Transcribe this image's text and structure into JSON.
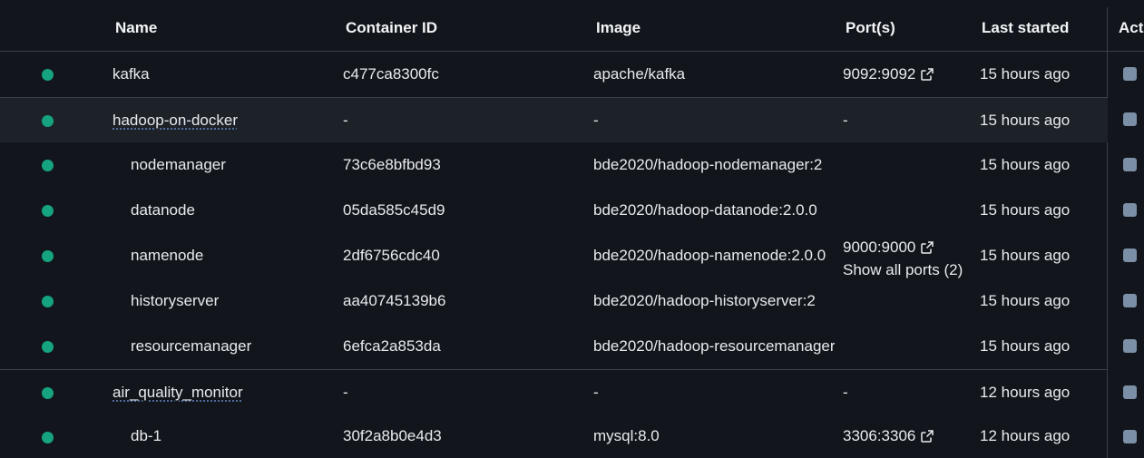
{
  "header": {
    "name": "Name",
    "container_id": "Container ID",
    "image": "Image",
    "ports": "Port(s)",
    "last_started": "Last started",
    "actions": "Act"
  },
  "rows": [
    {
      "name": "kafka",
      "container_id": "c477ca8300fc",
      "image": "apache/kafka",
      "ports": "9092:9092",
      "last_started": "15 hours ago",
      "status": "running",
      "is_group": false
    },
    {
      "name": "hadoop-on-docker",
      "container_id": "-",
      "image": "-",
      "ports": "-",
      "last_started": "15 hours ago",
      "status": "running",
      "is_group": true
    },
    {
      "name": "nodemanager",
      "container_id": "73c6e8bfbd93",
      "image": "bde2020/hadoop-nodemanager:2",
      "ports": "",
      "last_started": "15 hours ago",
      "status": "running",
      "is_group": false
    },
    {
      "name": "datanode",
      "container_id": "05da585c45d9",
      "image": "bde2020/hadoop-datanode:2.0.0",
      "ports": "",
      "last_started": "15 hours ago",
      "status": "running",
      "is_group": false
    },
    {
      "name": "namenode",
      "container_id": "2df6756cdc40",
      "image": "bde2020/hadoop-namenode:2.0.0",
      "ports": "9000:9000",
      "ports_more": "Show all ports (2)",
      "last_started": "15 hours ago",
      "status": "running",
      "is_group": false
    },
    {
      "name": "historyserver",
      "container_id": "aa40745139b6",
      "image": "bde2020/hadoop-historyserver:2",
      "ports": "",
      "last_started": "15 hours ago",
      "status": "running",
      "is_group": false
    },
    {
      "name": "resourcemanager",
      "container_id": "6efca2a853da",
      "image": "bde2020/hadoop-resourcemanager",
      "ports": "",
      "last_started": "15 hours ago",
      "status": "running",
      "is_group": false
    },
    {
      "name": "air_quality_monitor",
      "container_id": "-",
      "image": "-",
      "ports": "-",
      "last_started": "12 hours ago",
      "status": "running",
      "is_group": true
    },
    {
      "name": "db-1",
      "container_id": "30f2a8b0e4d3",
      "image": "mysql:8.0",
      "ports": "3306:3306",
      "last_started": "12 hours ago",
      "status": "running",
      "is_group": false
    }
  ],
  "colors": {
    "background": "#12161c",
    "running": "#16a37f",
    "checkbox": "#7b8fa6",
    "hover_row": "#1d2229"
  },
  "icons": {
    "external_link": "external-link-icon"
  }
}
